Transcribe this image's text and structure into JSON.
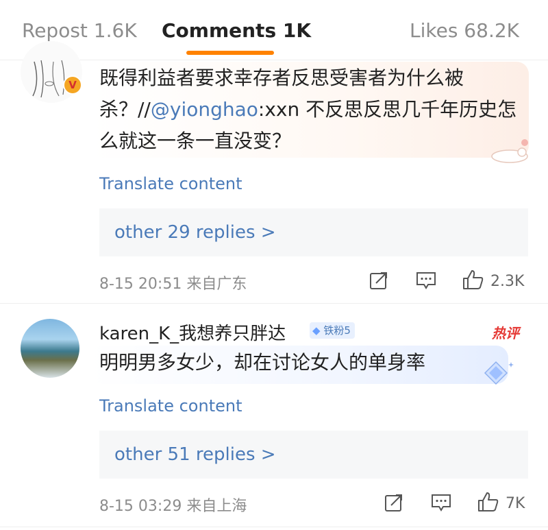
{
  "tabs": {
    "repost": "Repost 1.6K",
    "comments": "Comments 1K",
    "likes": "Likes 68.2K"
  },
  "comments": [
    {
      "body_before": "既得利益者要求幸存者反思受害者为什么被杀？//",
      "mention": "@yionghao",
      "body_after": ":xxn 不反思反思几千年历史怎么就这一条一直没变？",
      "translate": "Translate content",
      "replies": "other 29 replies >",
      "meta": "8-15 20:51 来自广东",
      "likes": "2.3K"
    },
    {
      "username": "karen_K_我想养只胖达",
      "fan_badge": "铁粉5",
      "hot_tag": "热评",
      "body": "明明男多女少，却在讨论女人的单身率",
      "translate": "Translate content",
      "replies": "other 51 replies >",
      "meta": "8-15 03:29 来自上海",
      "likes": "7K"
    }
  ],
  "colors": {
    "accent": "#ff8200",
    "link": "#4a7ab8",
    "muted": "#8c8c8c",
    "hot": "#e53935"
  }
}
